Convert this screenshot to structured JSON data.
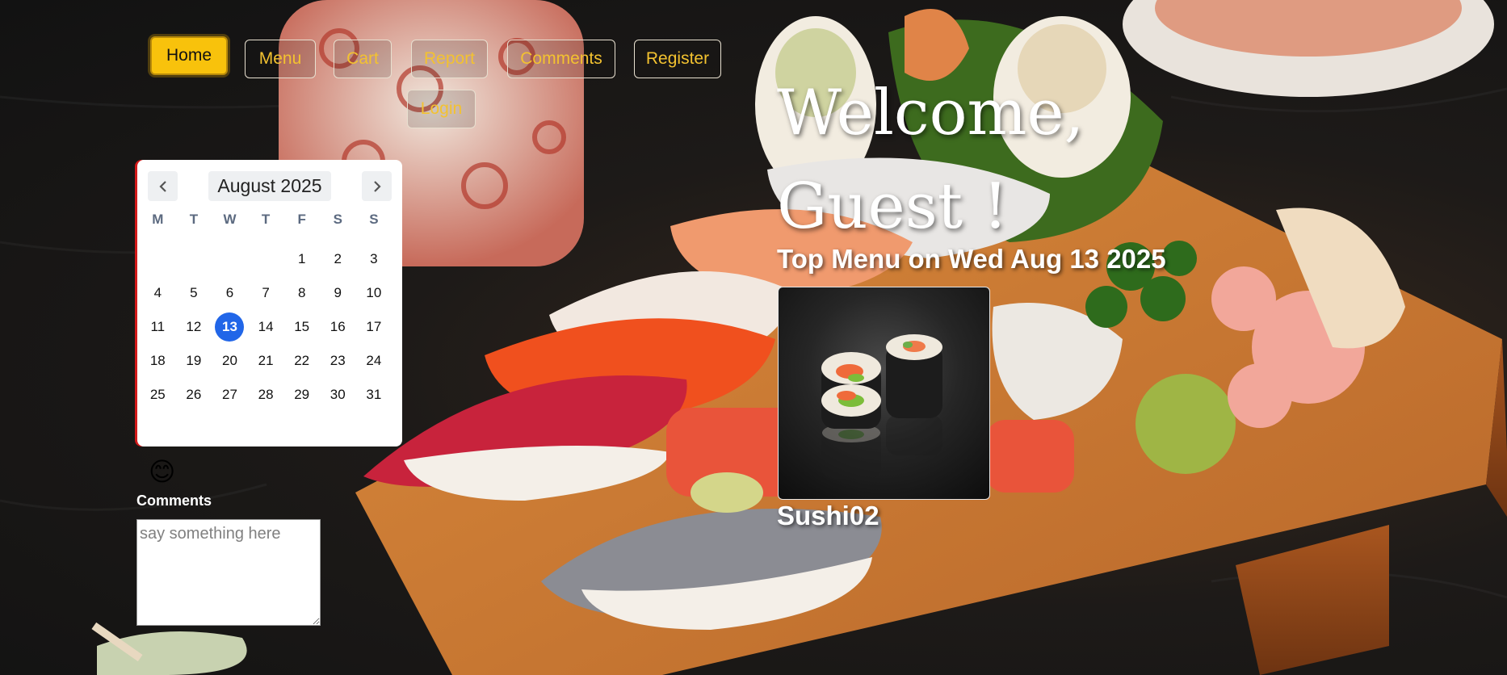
{
  "nav": {
    "items": [
      {
        "label": "Home",
        "active": true
      },
      {
        "label": "Menu",
        "active": false
      },
      {
        "label": "Cart",
        "active": false
      },
      {
        "label": "Report",
        "active": false
      },
      {
        "label": "Comments",
        "active": false
      },
      {
        "label": "Register",
        "active": false
      },
      {
        "label": "Login",
        "active": false
      }
    ]
  },
  "welcome": {
    "line1": "Welcome,",
    "line2": "Guest !",
    "top_menu": "Top Menu on Wed Aug 13 2025"
  },
  "dish": {
    "name": "Sushi02"
  },
  "calendar": {
    "title": "August 2025",
    "prev_icon": "chevron-left-icon",
    "next_icon": "chevron-right-icon",
    "weekdays": [
      "M",
      "T",
      "W",
      "T",
      "F",
      "S",
      "S"
    ],
    "leading_blanks": 4,
    "days": [
      "1",
      "2",
      "3",
      "4",
      "5",
      "6",
      "7",
      "8",
      "9",
      "10",
      "11",
      "12",
      "13",
      "14",
      "15",
      "16",
      "17",
      "18",
      "19",
      "20",
      "21",
      "22",
      "23",
      "24",
      "25",
      "26",
      "27",
      "28",
      "29",
      "30",
      "31"
    ],
    "today": "13",
    "today_color": "#2166e8"
  },
  "comments": {
    "emoji": "😊",
    "label": "Comments",
    "placeholder": "say something here"
  },
  "colors": {
    "accent": "#f8c20c",
    "nav_text": "#f3c230"
  }
}
